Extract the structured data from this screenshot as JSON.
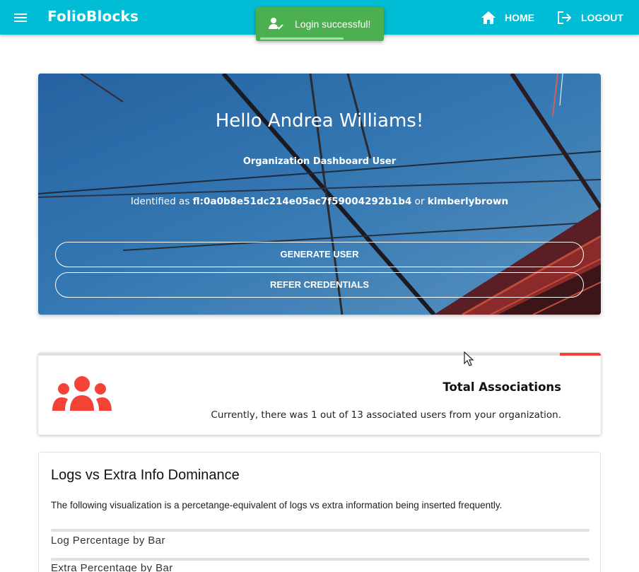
{
  "app": {
    "brand": "FolioBlocks",
    "nav": {
      "home_label": "HOME",
      "logout_label": "LOGOUT"
    },
    "icons": [
      "menu-icon",
      "home-icon",
      "logout-icon",
      "user-check-icon",
      "group-icon"
    ]
  },
  "toast": {
    "message": "Login successful!",
    "color": "#4caf50"
  },
  "hero": {
    "greeting": "Hello Andrea Williams!",
    "role": "Organization Dashboard User",
    "identified_prefix": "Identified as ",
    "identifier": "fl:0a0b8e51dc214e05ac7f59004292b1b4",
    "or_text": " or ",
    "username": "kimberlybrown",
    "buttons": {
      "generate": "GENERATE USER",
      "refer": "REFER CREDENTIALS"
    }
  },
  "associations": {
    "title": "Total Associations",
    "text": "Currently, there was 1 out of 13 associated users from your organization.",
    "accent_color": "#f44336"
  },
  "logs": {
    "title": "Logs vs Extra Info Dominance",
    "description": "The following visualization is a percetange-equivalent of logs vs extra information being inserted frequently.",
    "bars": [
      {
        "label": "Log Percentage by Bar"
      },
      {
        "label": "Extra Percentage by Bar"
      }
    ]
  },
  "colors": {
    "appbar": "#00bcd4",
    "accent": "#f44336",
    "success": "#4caf50"
  }
}
